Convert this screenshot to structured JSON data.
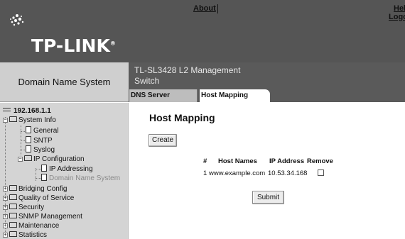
{
  "brand": {
    "logo_text": "TP-LINK",
    "logo_mark": "registered"
  },
  "header": {
    "section_title": "Domain Name System",
    "device_name": "TL-SL3428 L2 Management Switch",
    "links": {
      "about": "About",
      "help": "Hel",
      "logout": "Logo"
    }
  },
  "tabs": [
    {
      "label": "DNS Server",
      "active": false
    },
    {
      "label": "Host Mapping",
      "active": true
    }
  ],
  "sidebar": {
    "root": "192.168.1.1",
    "system_info": "System Info",
    "general": "General",
    "sntp": "SNTP",
    "syslog": "Syslog",
    "ip_configuration": "IP Configuration",
    "ip_addressing": "IP Addressing",
    "domain_name_system": "Domain Name System",
    "bridging_config": "Bridging Config",
    "quality_of_service": "Quality of Service",
    "security": "Security",
    "snmp_management": "SNMP Management",
    "maintenance": "Maintenance",
    "statistics": "Statistics"
  },
  "main": {
    "page_title": "Host Mapping",
    "create_label": "Create",
    "submit_label": "Submit",
    "table": {
      "columns": [
        "#",
        "Host Names",
        "IP Address",
        "Remove"
      ],
      "rows": [
        {
          "index": "1",
          "host_name": "www.example.com",
          "ip_address": "10.53.34.168",
          "remove": false
        }
      ]
    }
  },
  "colors": {
    "banner": "#555555",
    "title_bar": "#5a5a5a",
    "sidebar_bg": "#d4d4d4",
    "section_title_bg": "#cfcfcf"
  },
  "icons": [
    "tp-link-logo-icon",
    "switch-icon",
    "folder-icon",
    "document-icon",
    "expand-icon",
    "collapse-icon"
  ]
}
